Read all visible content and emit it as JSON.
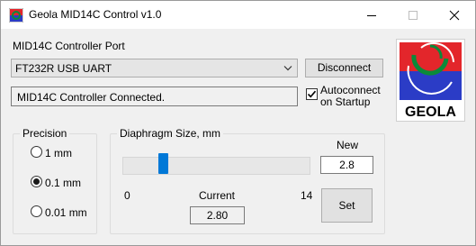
{
  "window": {
    "title": "Geola MID14C Control v1.0"
  },
  "controller": {
    "port_label": "MID14C Controller Port",
    "port_value": "FT232R USB UART",
    "disconnect_label": "Disconnect",
    "status_text": "MID14C Controller Connected.",
    "autoconnect_line1": "Autoconnect",
    "autoconnect_line2": "on Startup",
    "autoconnect_checked": true
  },
  "logo": {
    "text": "GEOLA",
    "colors": {
      "red": "#e3262b",
      "blue": "#2b3cc6",
      "green": "#0b8a3a"
    }
  },
  "precision": {
    "title": "Precision",
    "options": [
      {
        "label": "1 mm",
        "selected": false
      },
      {
        "label": "0.1 mm",
        "selected": true
      },
      {
        "label": "0.01 mm",
        "selected": false
      }
    ]
  },
  "diaphragm": {
    "title": "Diaphragm Size, mm",
    "min_label": "0",
    "max_label": "14",
    "slider_min": 0,
    "slider_max": 14,
    "slider_value": 2.8,
    "current_label": "Current",
    "current_value": "2.80",
    "new_label": "New",
    "new_value": "2.8",
    "set_label": "Set"
  },
  "colors": {
    "accent": "#0078d7",
    "window_bg": "#f0f0f0"
  }
}
